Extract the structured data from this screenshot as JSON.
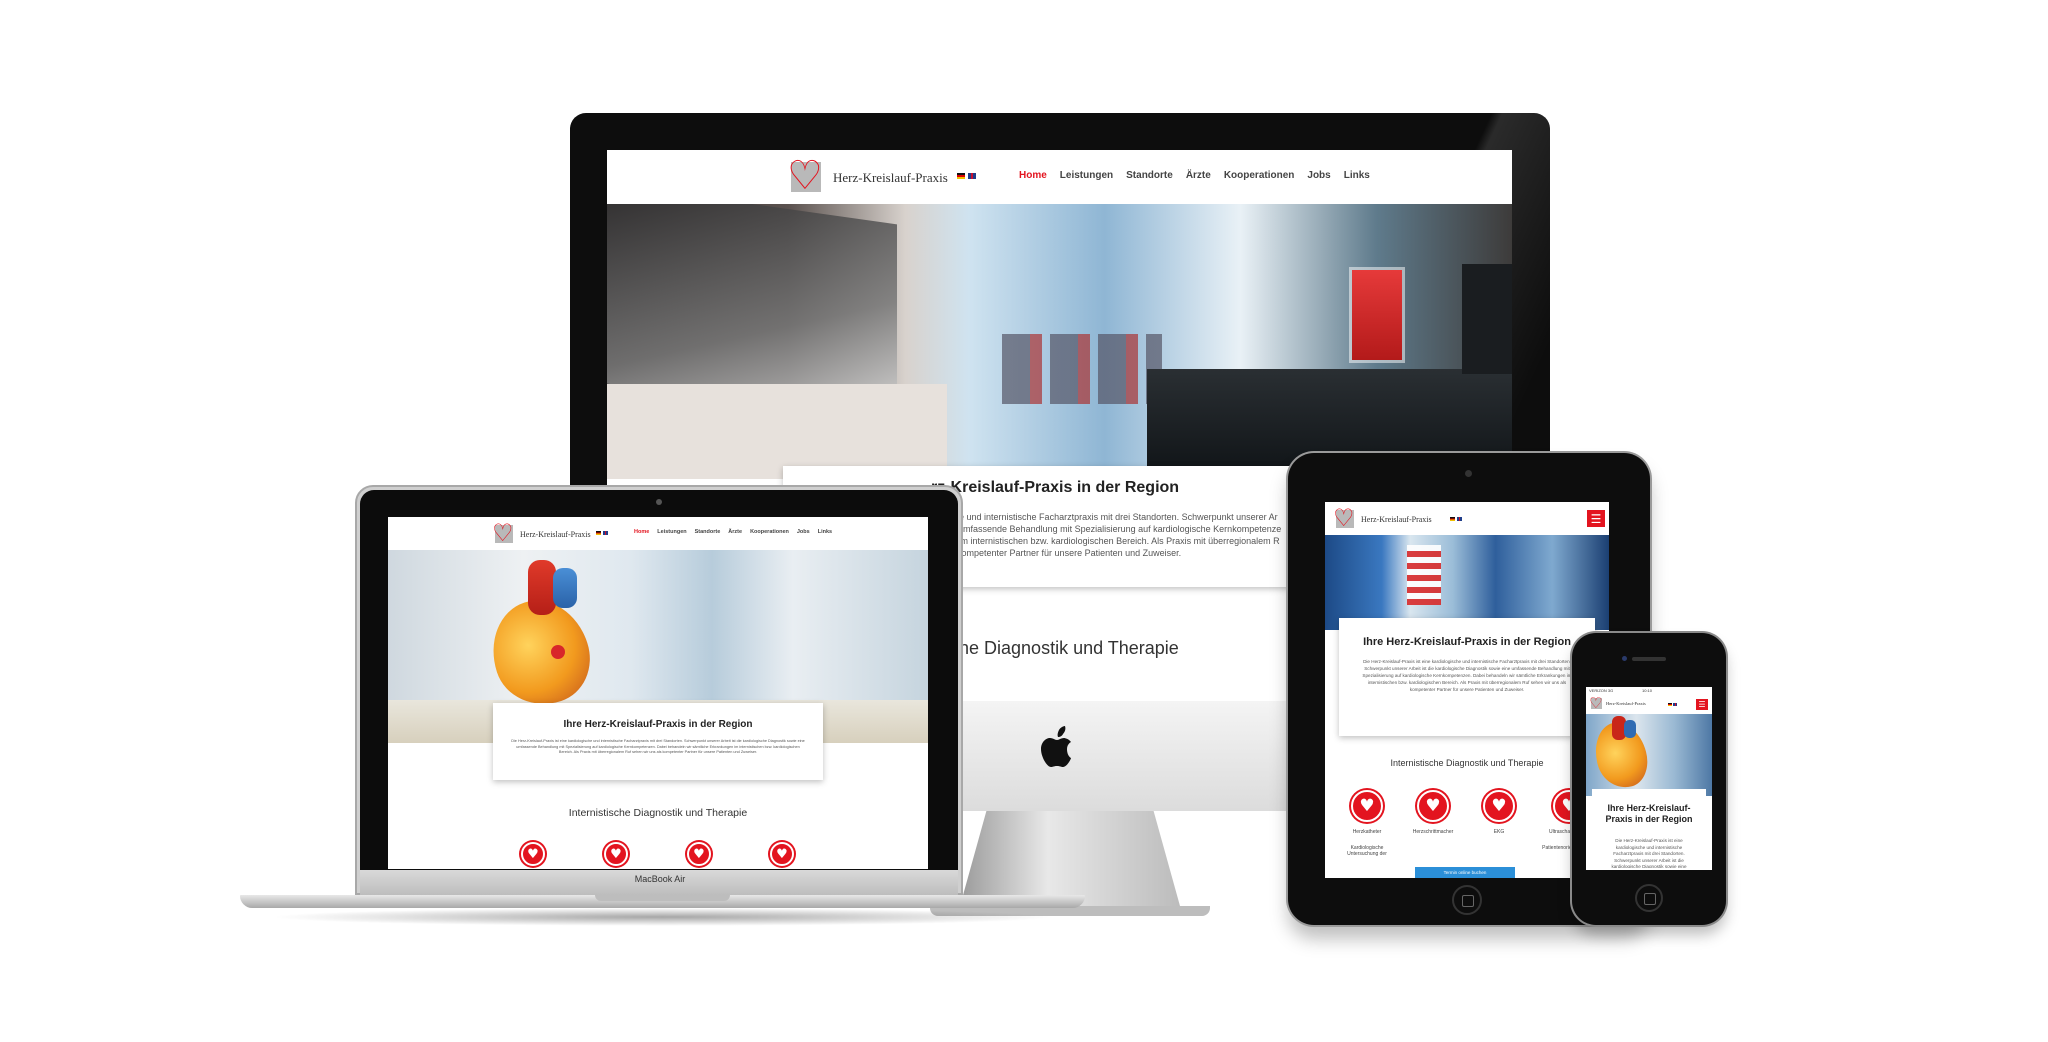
{
  "site": {
    "logo_text": "Herz-Kreislauf-Praxis",
    "menu": [
      "Home",
      "Leistungen",
      "Standorte",
      "Ärzte",
      "Kooperationen",
      "Jobs",
      "Links"
    ],
    "intro_title": "Ihre Herz-Kreislauf-Praxis in der Region",
    "intro_title_tablet": "Ihre Herz-Kreislauf-Praxis in der Region",
    "intro_title_phone": "Ihre Herz-Kreislauf-Praxis in der Region",
    "intro_text": "Die Herz-Kreislauf-Praxis ist eine kardiologische und internistische Facharztpraxis mit drei Standorten. Schwerpunkt unserer Arbeit ist die kardiologische Diagnostik sowie eine umfassende Behandlung mit Spezialisierung auf kardiologische Kernkompetenzen. Dabei behandeln wir sämtliche Erkrankungen im internistischen bzw. kardiologischen Bereich. Als Praxis mit überregionalem Ruf sehen wir uns als kompetenter Partner für unsere Patienten und Zuweiser.",
    "desktop_intro_title": "rz-Kreislauf-Praxis in der Region",
    "desktop_intro_lines": [
      "logische und internistische Facharztpraxis mit drei Standorten. Schwerpunkt unserer Ar",
      "e eine umfassende Behandlung mit Spezialisierung auf kardiologische Kernkompetenze",
      "ungen im internistischen bzw. kardiologischen Bereich. Als Praxis mit überregionalem R",
      "ns als kompetenter Partner für unsere Patienten und Zuweiser."
    ],
    "desktop_section_title": "tische Diagnostik und Therapie",
    "section_title": "Internistische Diagnostik und Therapie",
    "services": [
      "Herzkatheter",
      "Herzschrittmacher",
      "EKG",
      "Ultraschall"
    ],
    "services_tablet_labels": [
      "Herzkatheter",
      "Herzschrittmacher",
      "EKG",
      "Ultraschalluntersu"
    ],
    "services_tablet_sub": [
      "Kardiologische Untersuchung der",
      "",
      "",
      "Patientenorie Untersuch"
    ],
    "cookie_text": "Termin online buchen",
    "macbook_label": "MacBook Air",
    "phone_status": "VERIZON  3G",
    "phone_time": "10:10"
  },
  "icons": {
    "hero_heart": "heart-logo-icon",
    "apple": "apple-logo-icon",
    "hamburger": "hamburger-menu-icon"
  },
  "colors": {
    "brand_red": "#e3141f",
    "frame_black": "#0d0d0d",
    "silver": "#c9c9c9"
  }
}
